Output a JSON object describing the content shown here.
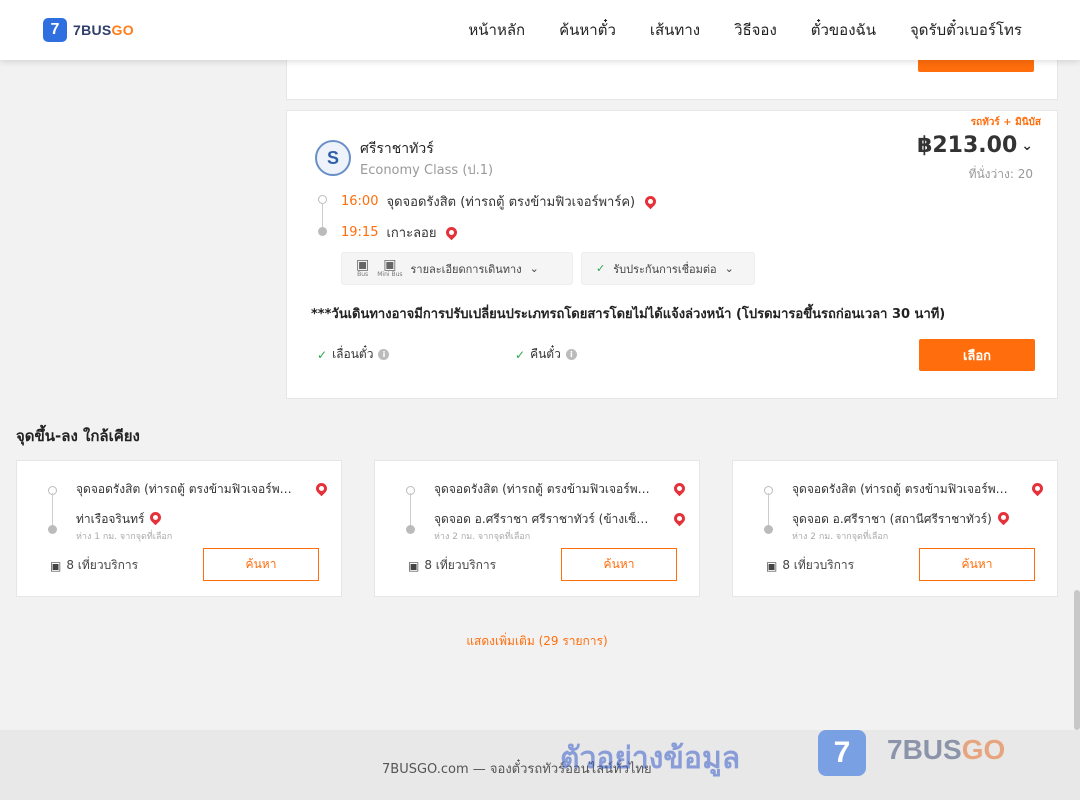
{
  "header": {
    "logo_mark": "7",
    "logo_text": "7BUS",
    "logo_text_go": "GO",
    "nav": [
      "หน้าหลัก",
      "ค้นหาตั๋ว",
      "เส้นทาง",
      "วิธีจอง",
      "ตั๋วของฉัน",
      "จุดรับตั๋วเบอร์โทร"
    ]
  },
  "trip": {
    "tag": "รถทัวร์ + มินิบัส",
    "operator": "ศรีราชาทัวร์",
    "operator_logo": "S",
    "class": "Economy Class (ป.1)",
    "price": "฿213.00",
    "seats": "ที่นั่งว่าง: 20",
    "departure_time": "16:00",
    "departure_place": "จุดจอดรังสิต (ท่ารถตู้ ตรงข้ามฟิวเจอร์พาร์ค)",
    "arrival_time": "19:15",
    "arrival_place": "เกาะลอย",
    "bus_label": "Bus",
    "minibus_label": "Mini Bus",
    "details_label": "รายละเอียดการเดินทาง",
    "insurance_label": "รับประกันการเชื่อมต่อ",
    "notice": "***วันเดินทางอาจมีการปรับเปลี่ยนประเภทรถโดยสารโดยไม่ได้แจ้งล่วงหน้า (โปรดมารอขึ้นรถก่อนเวลา 30 นาที)",
    "perk_change": "เลื่อนตั๋ว",
    "perk_refund": "คืนตั๋ว",
    "select_label": "เลือก"
  },
  "nearby": {
    "title": "จุดขึ้น-ลง ใกล้เคียง",
    "cards": [
      {
        "from": "จุดจอดรังสิต (ท่ารถตู้ ตรงข้ามฟิวเจอร์พาร์ค)",
        "to": "ท่าเรือจรินทร์",
        "distance": "ห่าง 1 กม. จากจุดที่เลือก",
        "trips": "8 เที่ยวบริการ",
        "button": "ค้นหา"
      },
      {
        "from": "จุดจอดรังสิต (ท่ารถตู้ ตรงข้ามฟิวเจอร์พาร์ค)",
        "to": "จุดจอด อ.ศรีราชา ศรีราชาทัวร์ (ข้างเซ็นทรัล)",
        "distance": "ห่าง 2 กม. จากจุดที่เลือก",
        "trips": "8 เที่ยวบริการ",
        "button": "ค้นหา"
      },
      {
        "from": "จุดจอดรังสิต (ท่ารถตู้ ตรงข้ามฟิวเจอร์พาร์ค)",
        "to": "จุดจอด อ.ศรีราชา (สถานีศรีราชาทัวร์)",
        "distance": "ห่าง 2 กม. จากจุดที่เลือก",
        "trips": "8 เที่ยวบริการ",
        "button": "ค้นหา"
      }
    ],
    "more": "แสดงเพิ่มเติม (29 รายการ)"
  },
  "footer": {
    "text": "7BUSGO.com — จองตั๋วรถทัวร์ออนไลน์ทั่วไทย",
    "watermark": "ตัวอย่างข้อมูล",
    "wm_logo": "7",
    "wm_brand": "7BUS",
    "wm_brand_go": "GO"
  }
}
